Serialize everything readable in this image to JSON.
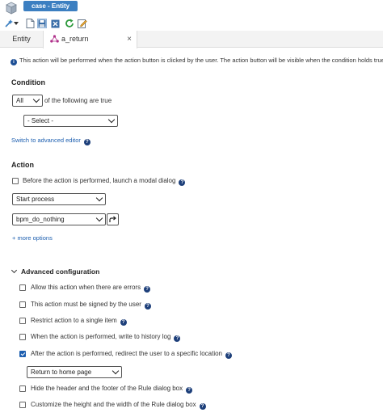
{
  "window": {
    "title": "case - Entity"
  },
  "tabs": [
    {
      "label": "Entity"
    },
    {
      "label": "a_return",
      "close": "×"
    }
  ],
  "info_text": "This action will be performed when the action button is clicked by the user. The action button will be visible when the condition holds true.",
  "condition": {
    "heading": "Condition",
    "quantifier": "All",
    "quantifier_suffix": "of the following are true",
    "select_placeholder": "- Select -",
    "advanced_link": "Switch to advanced editor"
  },
  "action": {
    "heading": "Action",
    "modal_checkbox_label": "Before the action is performed, launch a modal dialog",
    "action_type": "Start process",
    "process": "bpm_do_nothing",
    "more_options": "+ more options"
  },
  "advanced": {
    "heading": "Advanced configuration",
    "options": [
      {
        "label": "Allow this action when there are errors",
        "checked": false
      },
      {
        "label": "This action must be signed by the user",
        "checked": false
      },
      {
        "label": "Restrict action to a single item",
        "checked": false
      },
      {
        "label": "When the action is performed, write to history log",
        "checked": false
      },
      {
        "label": "After the action is performed, redirect the user to a specific location",
        "checked": true
      },
      {
        "label": "Hide the header and the footer of the Rule dialog box",
        "checked": false
      },
      {
        "label": "Customize the height and the width of the Rule dialog box",
        "checked": false
      }
    ],
    "redirect_target": "Return to home page"
  },
  "icons": {
    "help": "help-icon",
    "info": "info-icon",
    "accent": "#3c7fc1",
    "link": "#1d5fb0"
  }
}
